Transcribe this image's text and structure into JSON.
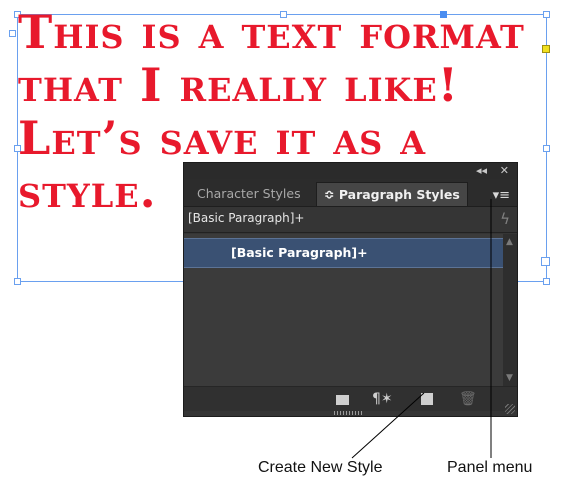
{
  "document": {
    "text_lines": [
      "This is a text format",
      "that I really like!",
      "Let’s save it as a",
      "style."
    ],
    "text_color": "#e8192c",
    "frame_color": "#6aa0ef"
  },
  "panel": {
    "topbar": {
      "collapse_glyph": "◂◂",
      "close_glyph": "✕"
    },
    "tabs": [
      {
        "label": "Character Styles",
        "active": false
      },
      {
        "label": "≎ Paragraph Styles",
        "active": true
      }
    ],
    "menu_glyph": "▾≡",
    "current_style": "[Basic Paragraph]+",
    "lightning_glyph": "ϟ",
    "styles_list": [
      {
        "label": "[Basic Paragraph]+",
        "selected": true
      }
    ],
    "selection_color": "#3a5173",
    "bottom_icons": {
      "clear_overrides": "¶✶",
      "delete": "🗑"
    }
  },
  "callouts": {
    "create_new_style": "Create New Style",
    "panel_menu": "Panel menu"
  }
}
